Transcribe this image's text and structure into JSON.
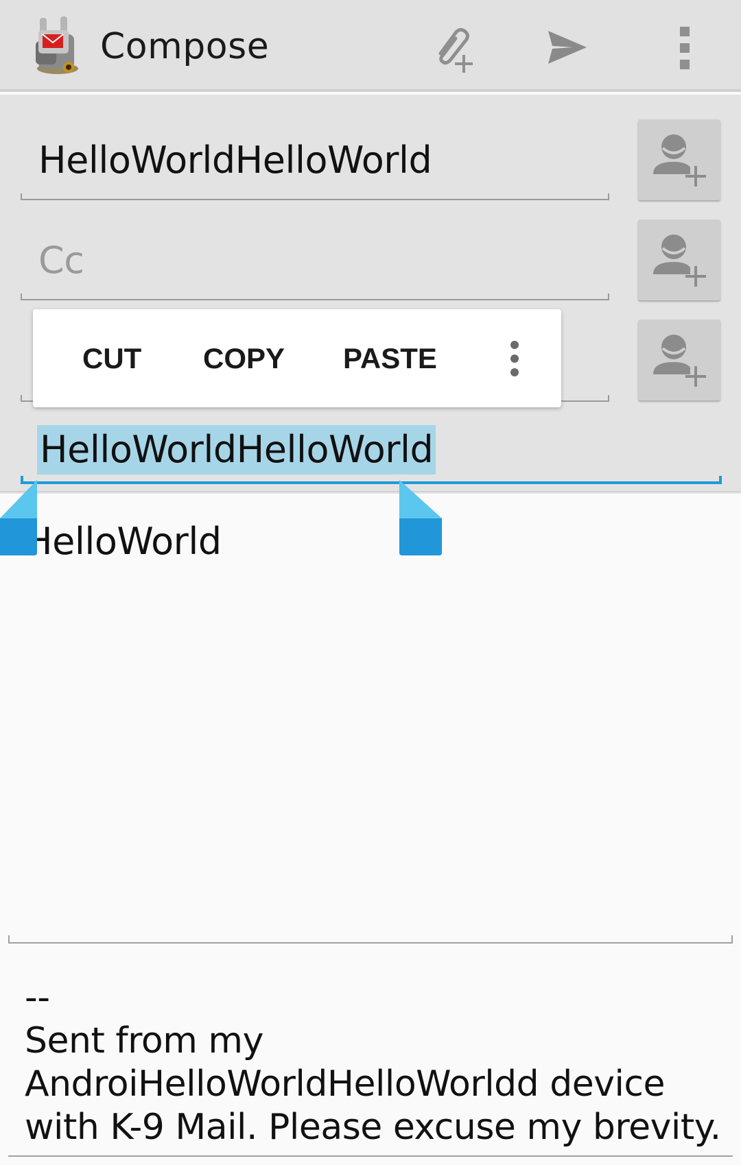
{
  "action_bar": {
    "title": "Compose",
    "icons": {
      "app": "k9-mail-app-icon",
      "attach": "attach-add-icon",
      "send": "send-icon",
      "overflow": "overflow-menu-icon"
    }
  },
  "fields": {
    "to_value": "HelloWorldHelloWorld",
    "cc_placeholder": "Cc",
    "bcc_placeholder": "",
    "subject_value": "HelloWorldHelloWorld"
  },
  "context_menu": {
    "cut": "CUT",
    "copy": "COPY",
    "paste": "PASTE"
  },
  "body": {
    "text": "HelloWorld",
    "signature": "--\nSent from my AndroiHelloWorldHelloWorldd device with K-9 Mail. Please excuse my brevity."
  },
  "colors": {
    "accent": "#1f9ad6",
    "selection": "#a6d5e8",
    "handle": "#2196d8"
  }
}
